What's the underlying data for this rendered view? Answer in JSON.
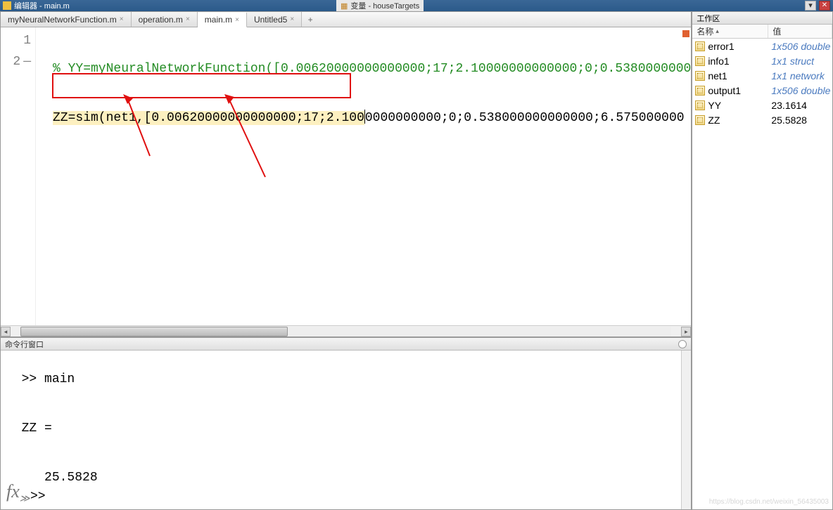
{
  "titlebar": {
    "title": "编辑器 - main.m"
  },
  "second_window": {
    "title": "变量 - houseTargets"
  },
  "tabs": {
    "items": [
      {
        "label": "myNeuralNetworkFunction.m",
        "active": false
      },
      {
        "label": "operation.m",
        "active": false
      },
      {
        "label": "main.m",
        "active": true
      },
      {
        "label": "Untitled5",
        "active": false
      }
    ],
    "add": "+"
  },
  "editor": {
    "lines": [
      {
        "num": "1",
        "dash": "",
        "comment": "% YY=myNeuralNetworkFunction([0.00620000000000000;17;2.10000000000000;0;0.5380000000"
      },
      {
        "num": "2",
        "dash": "—",
        "code_before": "ZZ=sim(net1,[0.00620000000000000;17;2.100",
        "code_after": "0000000000;0;0.538000000000000;6.575000000"
      }
    ]
  },
  "command_window": {
    "title": "命令行窗口",
    "lines": [
      ">> main",
      "",
      "ZZ =",
      "",
      "   25.5828",
      ""
    ],
    "prompt": ">>",
    "fx": "fx"
  },
  "workspace": {
    "title": "工作区",
    "col_name": "名称",
    "col_value": "值",
    "vars": [
      {
        "name": "error1",
        "value": "1x506 double",
        "italic": true
      },
      {
        "name": "info1",
        "value": "1x1 struct",
        "italic": true
      },
      {
        "name": "net1",
        "value": "1x1 network",
        "italic": true
      },
      {
        "name": "output1",
        "value": "1x506 double",
        "italic": true
      },
      {
        "name": "YY",
        "value": "23.1614",
        "italic": false
      },
      {
        "name": "ZZ",
        "value": "25.5828",
        "italic": false
      }
    ]
  },
  "watermark": "https://blog.csdn.net/weixin_56435003"
}
